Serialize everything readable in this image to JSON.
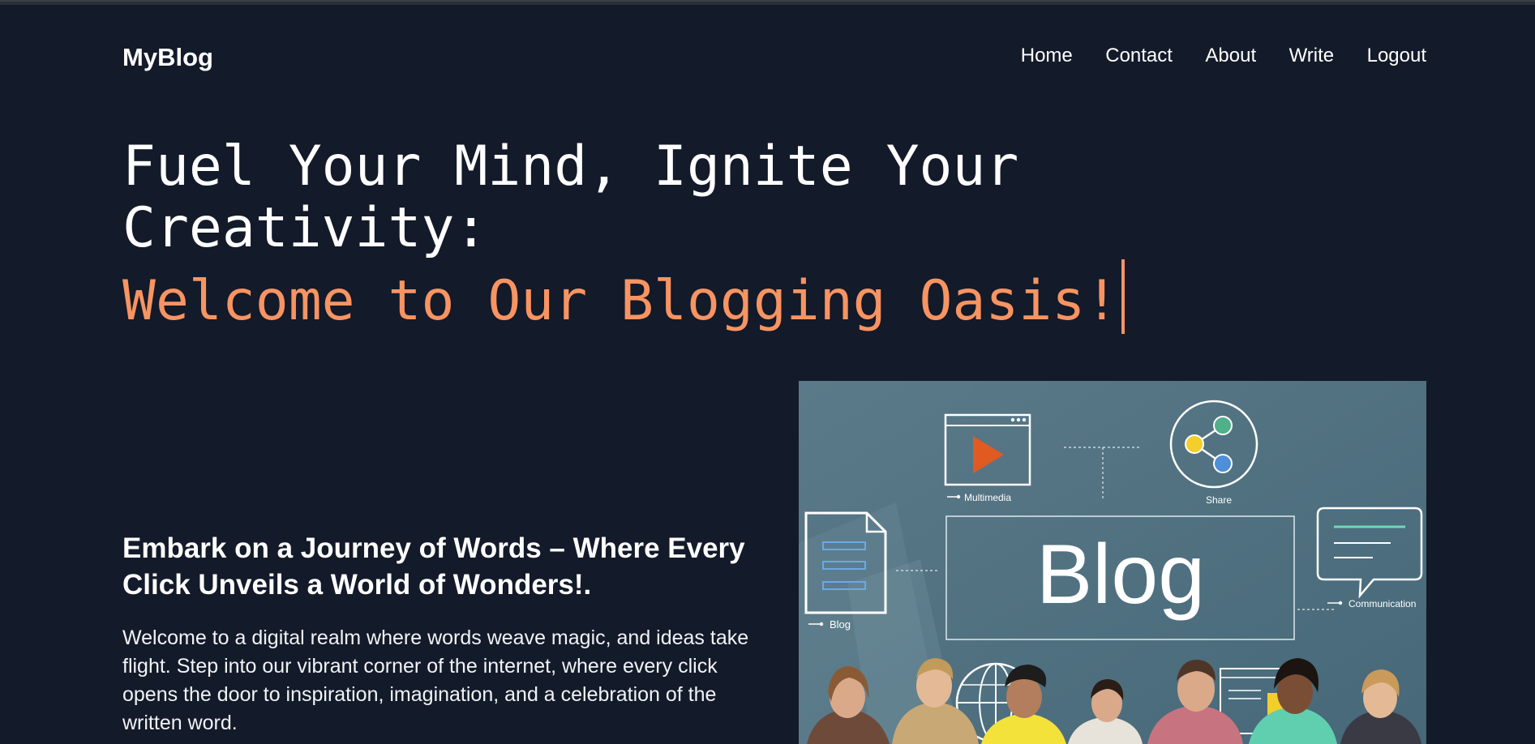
{
  "brand": {
    "name": "MyBlog"
  },
  "nav": {
    "items": [
      "Home",
      "Contact",
      "About",
      "Write",
      "Logout"
    ]
  },
  "hero": {
    "line1": "Fuel Your Mind, Ignite Your",
    "line2": "Creativity:",
    "line3": "Welcome to Our Blogging Oasis!"
  },
  "intro": {
    "heading": "Embark on a Journey of Words – Where Every Click Unveils a World of Wonders!.",
    "body": "Welcome to a digital realm where words weave magic, and ideas take flight. Step into our vibrant corner of the internet, where every click opens the door to inspiration, imagination, and a celebration of the written word."
  },
  "banner": {
    "title": "Blog",
    "labels": {
      "multimedia": "Multimedia",
      "share": "Share",
      "blog": "Blog",
      "communication": "Communication"
    }
  },
  "colors": {
    "background": "#131a29",
    "accent": "#f79462",
    "banner_bg": "#537181"
  }
}
